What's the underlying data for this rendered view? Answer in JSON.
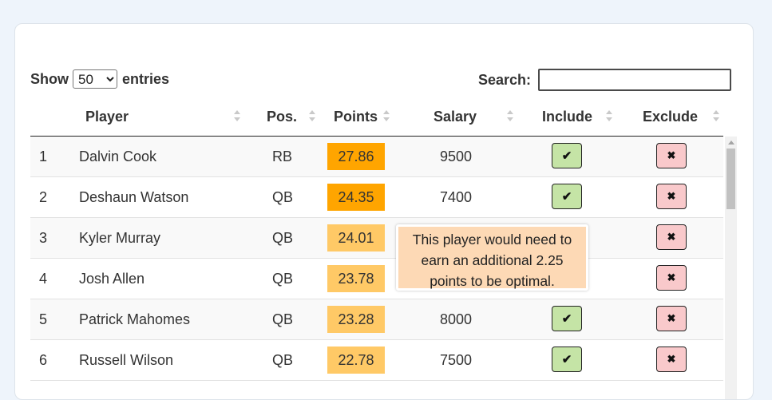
{
  "controls": {
    "show_label": "Show",
    "entries_selected": "50",
    "entries_label": "entries",
    "search_label": "Search:",
    "search_value": ""
  },
  "columns": [
    "Player",
    "Pos.",
    "Points",
    "Salary",
    "Include",
    "Exclude"
  ],
  "rows": [
    {
      "idx": "1",
      "player": "Dalvin Cook",
      "pos": "RB",
      "points": "27.86",
      "salary": "9500",
      "include_visible": true,
      "points_color": "#ffa500"
    },
    {
      "idx": "2",
      "player": "Deshaun Watson",
      "pos": "QB",
      "points": "24.35",
      "salary": "7400",
      "include_visible": true,
      "points_color": "#ffa500"
    },
    {
      "idx": "3",
      "player": "Kyler Murray",
      "pos": "QB",
      "points": "24.01",
      "salary": "",
      "include_visible": false,
      "points_color": "#ffc966"
    },
    {
      "idx": "4",
      "player": "Josh Allen",
      "pos": "QB",
      "points": "23.78",
      "salary": "",
      "include_visible": false,
      "points_color": "#ffc966"
    },
    {
      "idx": "5",
      "player": "Patrick Mahomes",
      "pos": "QB",
      "points": "23.28",
      "salary": "8000",
      "include_visible": true,
      "points_color": "#ffc966"
    },
    {
      "idx": "6",
      "player": "Russell Wilson",
      "pos": "QB",
      "points": "22.78",
      "salary": "7500",
      "include_visible": true,
      "points_color": "#ffc966"
    }
  ],
  "icons": {
    "include": "check-icon",
    "exclude": "close-icon"
  },
  "tooltip": {
    "line1": "This player would need to",
    "line2": "earn an additional 2.25",
    "line3": "points to be optimal."
  }
}
